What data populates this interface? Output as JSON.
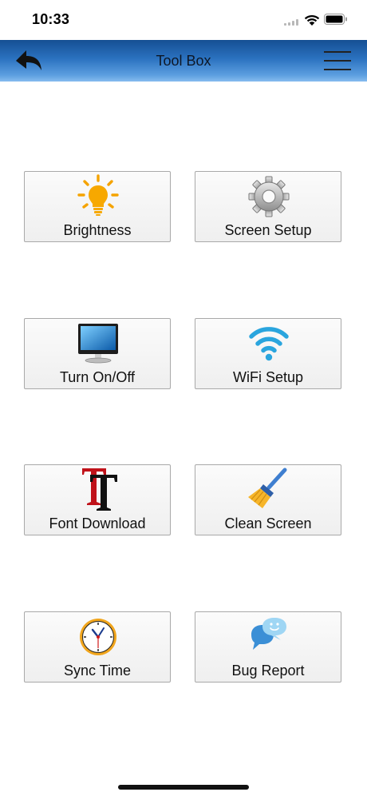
{
  "status_bar": {
    "time": "10:33"
  },
  "nav": {
    "title": "Tool Box",
    "back_icon": "back-arrow-icon",
    "menu_icon": "hamburger-menu-icon",
    "gradient_colors": [
      "#154f93",
      "#86bcef"
    ]
  },
  "tools": [
    {
      "label": "Brightness",
      "icon": "lightbulb-icon"
    },
    {
      "label": "Screen Setup",
      "icon": "gear-icon"
    },
    {
      "label": "Turn On/Off",
      "icon": "monitor-icon"
    },
    {
      "label": "WiFi Setup",
      "icon": "wifi-icon"
    },
    {
      "label": "Font Download",
      "icon": "font-icon"
    },
    {
      "label": "Clean Screen",
      "icon": "broom-icon"
    },
    {
      "label": "Sync Time",
      "icon": "clock-icon"
    },
    {
      "label": "Bug Report",
      "icon": "chat-bubble-icon"
    }
  ]
}
